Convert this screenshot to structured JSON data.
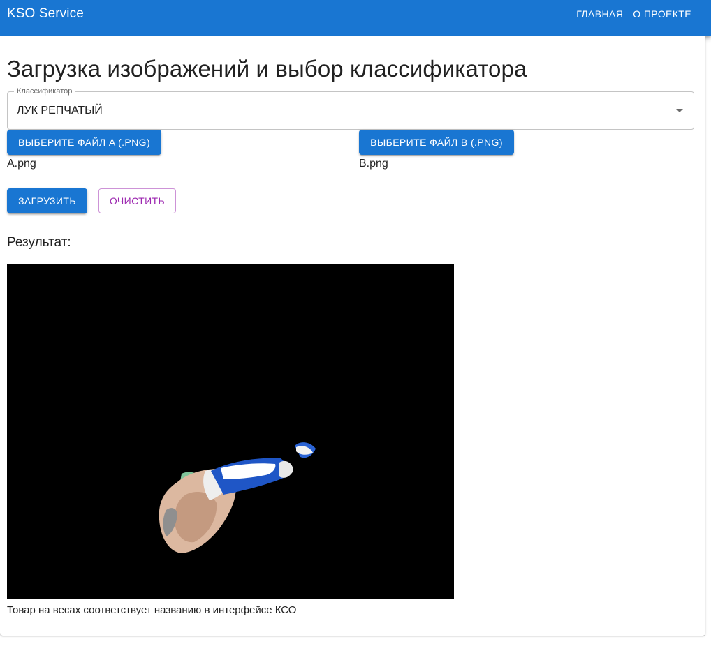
{
  "app": {
    "title": "KSO Service",
    "nav": [
      {
        "label": "ГЛАВНАЯ"
      },
      {
        "label": "О ПРОЕКТЕ"
      }
    ],
    "accent_color": "#1976d2",
    "secondary_color": "#9c27b0"
  },
  "page": {
    "title": "Загрузка изображений и выбор классификатора"
  },
  "classifier": {
    "label": "Классификатор",
    "value": "ЛУК РЕПЧАТЫЙ",
    "icon": "chevron-down-icon"
  },
  "files": {
    "a": {
      "button_label": "ВЫБЕРИТЕ ФАЙЛ A (.PNG)",
      "file_name": "A.png"
    },
    "b": {
      "button_label": "ВЫБЕРИТЕ ФАЙЛ B (.PNG)",
      "file_name": "B.png"
    }
  },
  "actions": {
    "upload_label": "ЗАГРУЗИТЬ",
    "clear_label": "ОЧИСТИТЬ"
  },
  "result": {
    "label": "Результат:",
    "caption": "Товар на весах соответствует названию в интерфейсе КСО"
  }
}
